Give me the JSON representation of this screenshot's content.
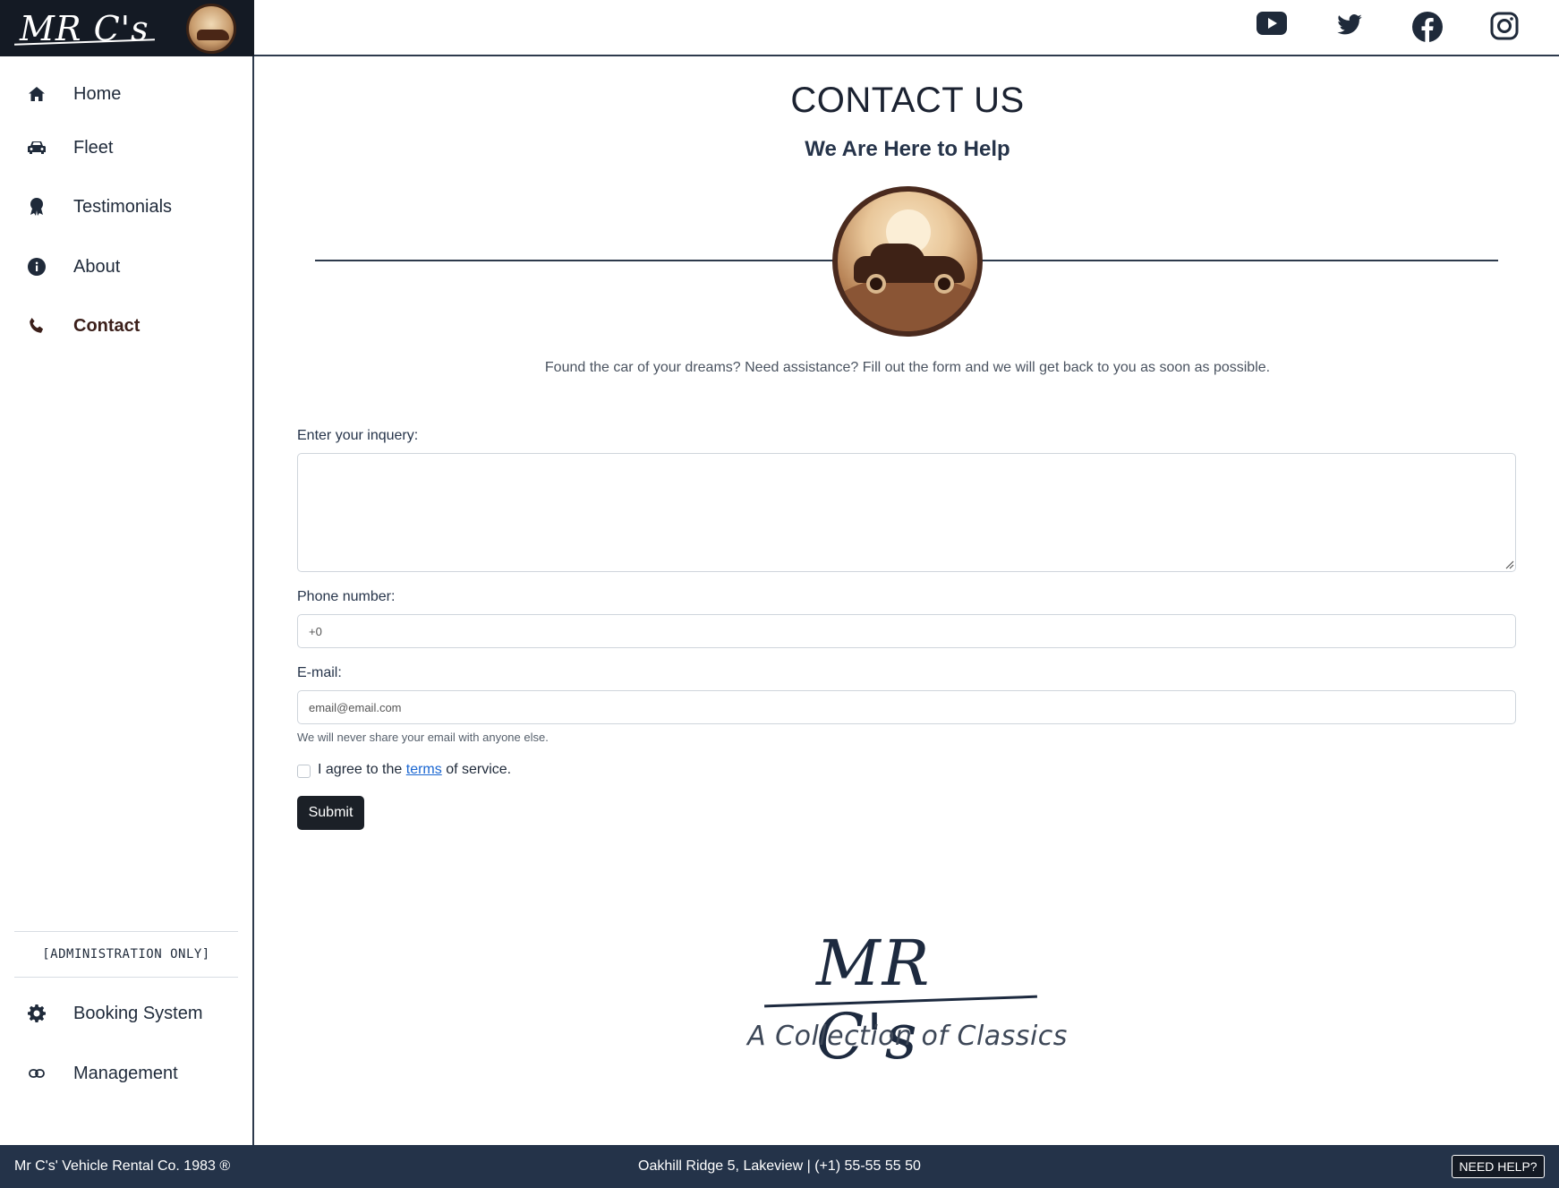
{
  "brand": {
    "logo_text": "MR C's"
  },
  "social": [
    {
      "name": "youtube-icon"
    },
    {
      "name": "twitter-icon"
    },
    {
      "name": "facebook-icon"
    },
    {
      "name": "instagram-icon"
    }
  ],
  "sidebar": {
    "items": [
      {
        "label": "Home",
        "icon": "home-icon"
      },
      {
        "label": "Fleet",
        "icon": "car-icon"
      },
      {
        "label": "Testimonials",
        "icon": "award-icon"
      },
      {
        "label": "About",
        "icon": "info-icon"
      },
      {
        "label": "Contact",
        "icon": "phone-icon",
        "active": true
      }
    ],
    "admin_label": "[ADMINISTRATION ONLY]",
    "admin_items": [
      {
        "label": "Booking System",
        "icon": "gear-icon"
      },
      {
        "label": "Management",
        "icon": "link-icon"
      }
    ]
  },
  "main": {
    "title": "CONTACT US",
    "subtitle": "We Are Here to Help",
    "intro": "Found the car of your dreams? Need assistance? Fill out the form and we will get back to you as soon as possible.",
    "form": {
      "inquiry_label": "Enter your inquery:",
      "inquiry_value": "",
      "phone_label": "Phone number:",
      "phone_placeholder": "+0",
      "email_label": "E-mail:",
      "email_placeholder": "email@email.com",
      "email_help": "We will never share your email with anyone else.",
      "terms_prefix": "I agree to the",
      "terms_link": "terms",
      "terms_suffix": "of service.",
      "terms_checked": false,
      "submit_label": "Submit"
    },
    "footer_logo_text": "MR C's",
    "tagline": "A Collection of Classics"
  },
  "footer": {
    "copyright": "Mr C's' Vehicle Rental Co. 1983 ®",
    "address": "Oakhill Ridge 5, Lakeview | (+1) 55-55 55 50",
    "help_button": "NEED HELP?"
  },
  "colors": {
    "navy": "#243349",
    "dark": "#141a24",
    "accent_brown": "#3b1f1a",
    "link": "#1a66d1"
  }
}
